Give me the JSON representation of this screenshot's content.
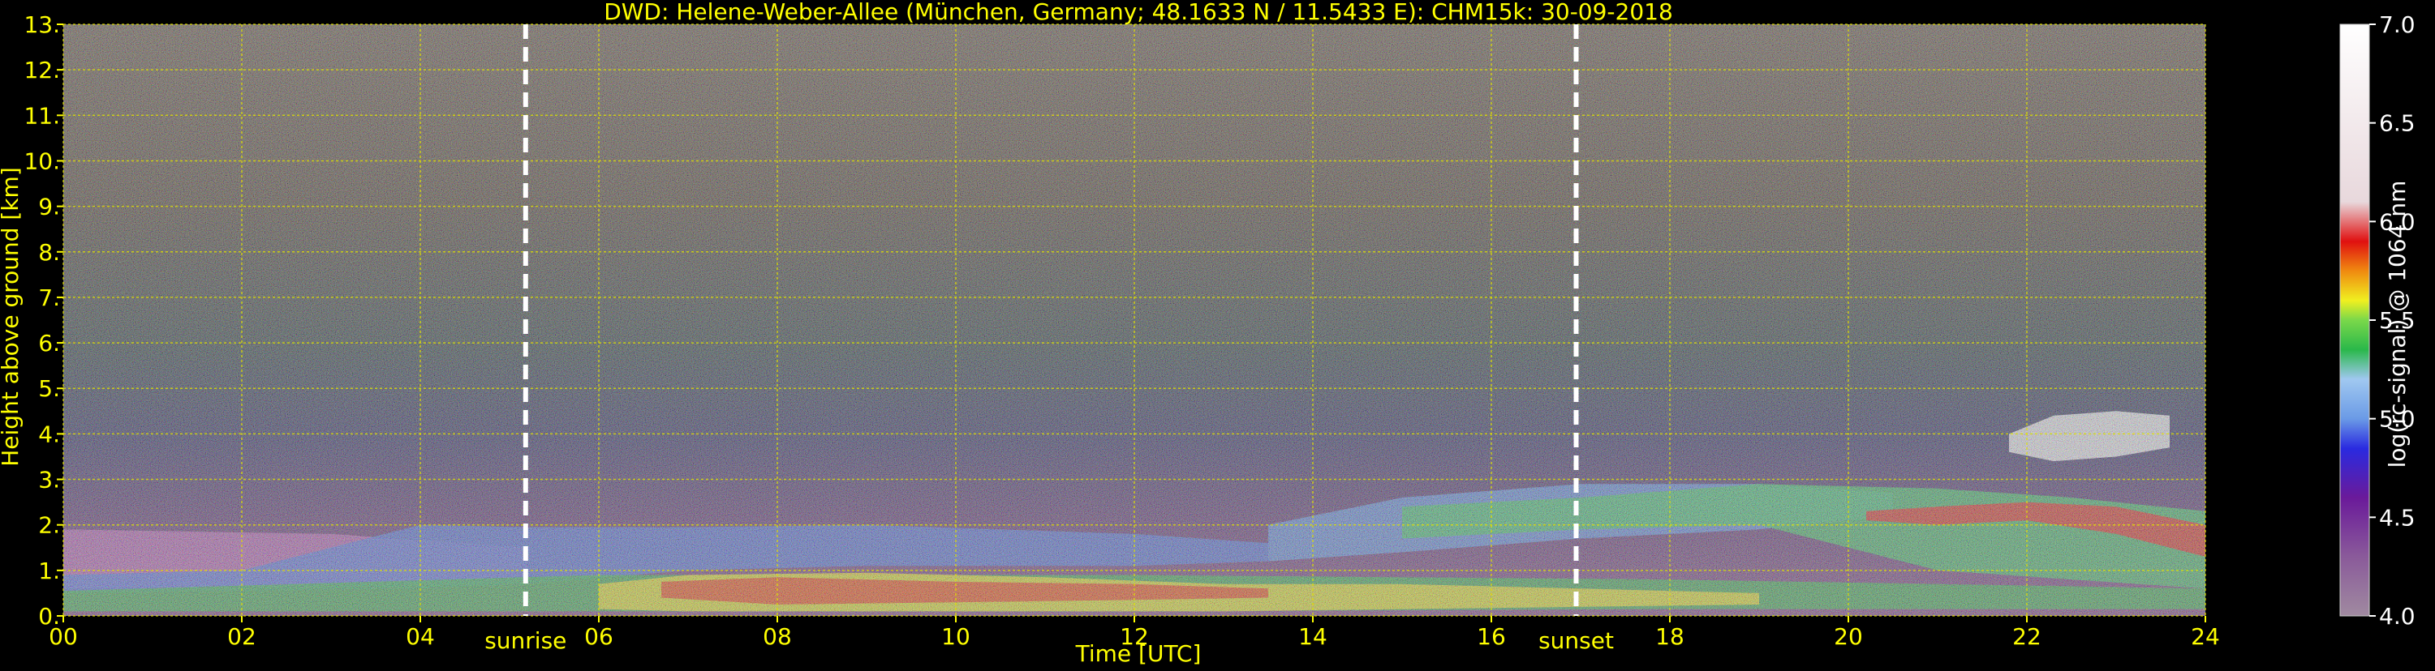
{
  "chart_data": {
    "type": "heatmap",
    "title": "DWD: Helene-Weber-Allee (München, Germany; 48.1633 N / 11.5433 E):    CHM15k: 30-09-2018",
    "xlabel": "Time [UTC]",
    "ylabel": "Height above ground [km]",
    "xlim": [
      0,
      24
    ],
    "ylim": [
      0,
      13
    ],
    "x_ticks": [
      {
        "v": 0,
        "label": "00"
      },
      {
        "v": 2,
        "label": "02"
      },
      {
        "v": 4,
        "label": "04"
      },
      {
        "v": 6,
        "label": "06"
      },
      {
        "v": 8,
        "label": "08"
      },
      {
        "v": 10,
        "label": "10"
      },
      {
        "v": 12,
        "label": "12"
      },
      {
        "v": 14,
        "label": "14"
      },
      {
        "v": 16,
        "label": "16"
      },
      {
        "v": 18,
        "label": "18"
      },
      {
        "v": 20,
        "label": "20"
      },
      {
        "v": 22,
        "label": "22"
      },
      {
        "v": 24,
        "label": "24"
      }
    ],
    "y_ticks": [
      {
        "v": 0,
        "label": "0."
      },
      {
        "v": 1,
        "label": "1."
      },
      {
        "v": 2,
        "label": "2."
      },
      {
        "v": 3,
        "label": "3."
      },
      {
        "v": 4,
        "label": "4."
      },
      {
        "v": 5,
        "label": "5."
      },
      {
        "v": 6,
        "label": "6."
      },
      {
        "v": 7,
        "label": "7."
      },
      {
        "v": 8,
        "label": "8."
      },
      {
        "v": 9,
        "label": "9."
      },
      {
        "v": 10,
        "label": "10."
      },
      {
        "v": 11,
        "label": "11."
      },
      {
        "v": 12,
        "label": "12."
      },
      {
        "v": 13,
        "label": "13."
      }
    ],
    "grid": true,
    "events": [
      {
        "name": "sunrise",
        "time": 5.18
      },
      {
        "name": "sunset",
        "time": 16.95
      }
    ],
    "colorbar": {
      "label": "log(rc-signal) @ 1064 nm",
      "range": [
        4.0,
        7.0
      ],
      "ticks": [
        {
          "v": 4.0,
          "label": "4.0"
        },
        {
          "v": 4.5,
          "label": "4.5"
        },
        {
          "v": 5.0,
          "label": "5.0"
        },
        {
          "v": 5.5,
          "label": "5.5"
        },
        {
          "v": 6.0,
          "label": "6.0"
        },
        {
          "v": 6.5,
          "label": "6.5"
        },
        {
          "v": 7.0,
          "label": "7.0"
        }
      ],
      "stops": [
        {
          "v": 4.0,
          "color": "#a08aa0"
        },
        {
          "v": 4.3,
          "color": "#8a5a9a"
        },
        {
          "v": 4.6,
          "color": "#6a1a9a"
        },
        {
          "v": 4.85,
          "color": "#2a2ae0"
        },
        {
          "v": 5.0,
          "color": "#6a9ae6"
        },
        {
          "v": 5.2,
          "color": "#a0c8f0"
        },
        {
          "v": 5.35,
          "color": "#2ab84a"
        },
        {
          "v": 5.5,
          "color": "#7ad84a"
        },
        {
          "v": 5.6,
          "color": "#f0f020"
        },
        {
          "v": 5.75,
          "color": "#f08a10"
        },
        {
          "v": 5.9,
          "color": "#e01010"
        },
        {
          "v": 6.1,
          "color": "#e8d8dc"
        },
        {
          "v": 7.0,
          "color": "#ffffff"
        }
      ]
    },
    "layers": [
      {
        "name": "night residual layer",
        "color": "#b860b8",
        "t": [
          0,
          3,
          5.2,
          5.2,
          3,
          0
        ],
        "h": [
          0.6,
          0.65,
          0.7,
          1.5,
          1.8,
          1.9
        ]
      },
      {
        "name": "lower blue layer",
        "color": "#4a70e0",
        "t": [
          0,
          2,
          4,
          5.2,
          7,
          9,
          12,
          13.5,
          13.5,
          12,
          9,
          7,
          5.2,
          4,
          2,
          0
        ],
        "h": [
          0.5,
          0.55,
          0.6,
          0.7,
          1.0,
          1.1,
          1.1,
          1.2,
          1.6,
          1.8,
          2.0,
          1.95,
          1.95,
          2.0,
          1.0,
          0.9
        ]
      },
      {
        "name": "surface green layer",
        "color": "#30b048",
        "t": [
          0,
          6,
          12,
          18,
          24,
          24,
          18,
          12,
          6,
          0
        ],
        "h": [
          0.1,
          0.1,
          0.1,
          0.15,
          0.15,
          0.6,
          0.8,
          0.9,
          0.9,
          0.55
        ]
      },
      {
        "name": "daytime mixing layer",
        "color": "#f0e020",
        "t": [
          6,
          7,
          9,
          11,
          13,
          15,
          17,
          19,
          19,
          17,
          15,
          13,
          11,
          9,
          7,
          6
        ],
        "h": [
          0.15,
          0.1,
          0.1,
          0.1,
          0.1,
          0.15,
          0.2,
          0.25,
          0.5,
          0.6,
          0.7,
          0.7,
          0.85,
          0.95,
          0.9,
          0.7
        ]
      },
      {
        "name": "daytime core",
        "color": "#e83010",
        "t": [
          6.7,
          8,
          10,
          12,
          13.5,
          13.5,
          12,
          10,
          8,
          6.7
        ],
        "h": [
          0.4,
          0.25,
          0.3,
          0.35,
          0.4,
          0.6,
          0.7,
          0.75,
          0.85,
          0.75
        ]
      },
      {
        "name": "evening blue layer",
        "color": "#5a90e8",
        "t": [
          13.5,
          15,
          17,
          19,
          20.5,
          20.5,
          19,
          17,
          15,
          13.5
        ],
        "h": [
          1.2,
          1.4,
          1.7,
          1.9,
          2.2,
          2.7,
          2.9,
          2.9,
          2.6,
          2.0
        ]
      },
      {
        "name": "evening green layer",
        "color": "#38c060",
        "t": [
          15,
          17,
          19,
          21,
          22.5,
          24,
          24,
          22.5,
          21,
          19,
          17,
          15
        ],
        "h": [
          1.7,
          1.9,
          2.0,
          1.0,
          0.8,
          0.6,
          2.3,
          2.6,
          2.8,
          2.9,
          2.6,
          2.4
        ]
      },
      {
        "name": "night cloud base",
        "color": "#e81818",
        "t": [
          20.2,
          21,
          22,
          23,
          24,
          24,
          23,
          22,
          21,
          20.2
        ],
        "h": [
          2.1,
          2.0,
          2.1,
          1.8,
          1.3,
          2.0,
          2.4,
          2.5,
          2.4,
          2.3
        ]
      },
      {
        "name": "high cloud",
        "color": "#ffffff",
        "t": [
          21.8,
          22.3,
          23,
          23.6,
          23.6,
          23,
          22.3,
          21.8
        ],
        "h": [
          3.6,
          3.4,
          3.5,
          3.7,
          4.4,
          4.5,
          4.4,
          4.0
        ]
      }
    ]
  }
}
